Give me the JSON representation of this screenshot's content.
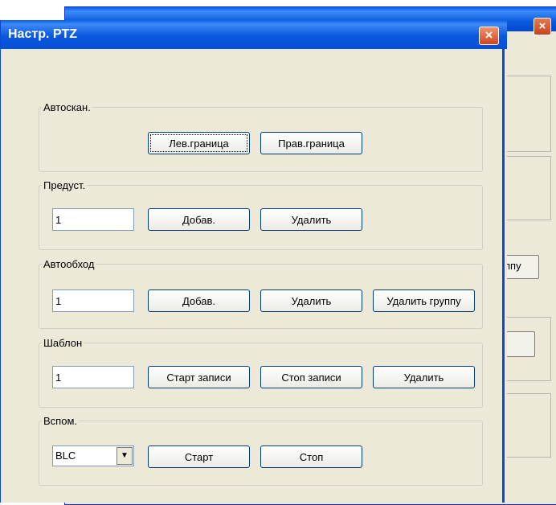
{
  "background_window": {
    "partial_button_label": "ппу"
  },
  "dialog": {
    "title": "Настр. PTZ",
    "close_label": "×"
  },
  "autoscan": {
    "legend": "Автоскан.",
    "left_bound_label": "Лев.граница",
    "right_bound_label": "Прав.граница"
  },
  "preset": {
    "legend": "Предуст.",
    "value": "1",
    "add_label": "Добав.",
    "delete_label": "Удалить"
  },
  "tour": {
    "legend": "Автообход",
    "value": "1",
    "add_label": "Добав.",
    "delete_label": "Удалить",
    "delete_group_label": "Удалить группу"
  },
  "pattern": {
    "legend": "Шаблон",
    "value": "1",
    "start_record_label": "Старт записи",
    "stop_record_label": "Стоп записи",
    "delete_label": "Удалить"
  },
  "aux": {
    "legend": "Вспом.",
    "selected": "BLC",
    "start_label": "Старт",
    "stop_label": "Стоп"
  },
  "icons": {
    "close": "close-icon",
    "dropdown": "chevron-down-icon"
  },
  "colors": {
    "titlebar": "#0a58dd",
    "dialog_bg": "#ece9d8",
    "close_button": "#d0461f"
  }
}
